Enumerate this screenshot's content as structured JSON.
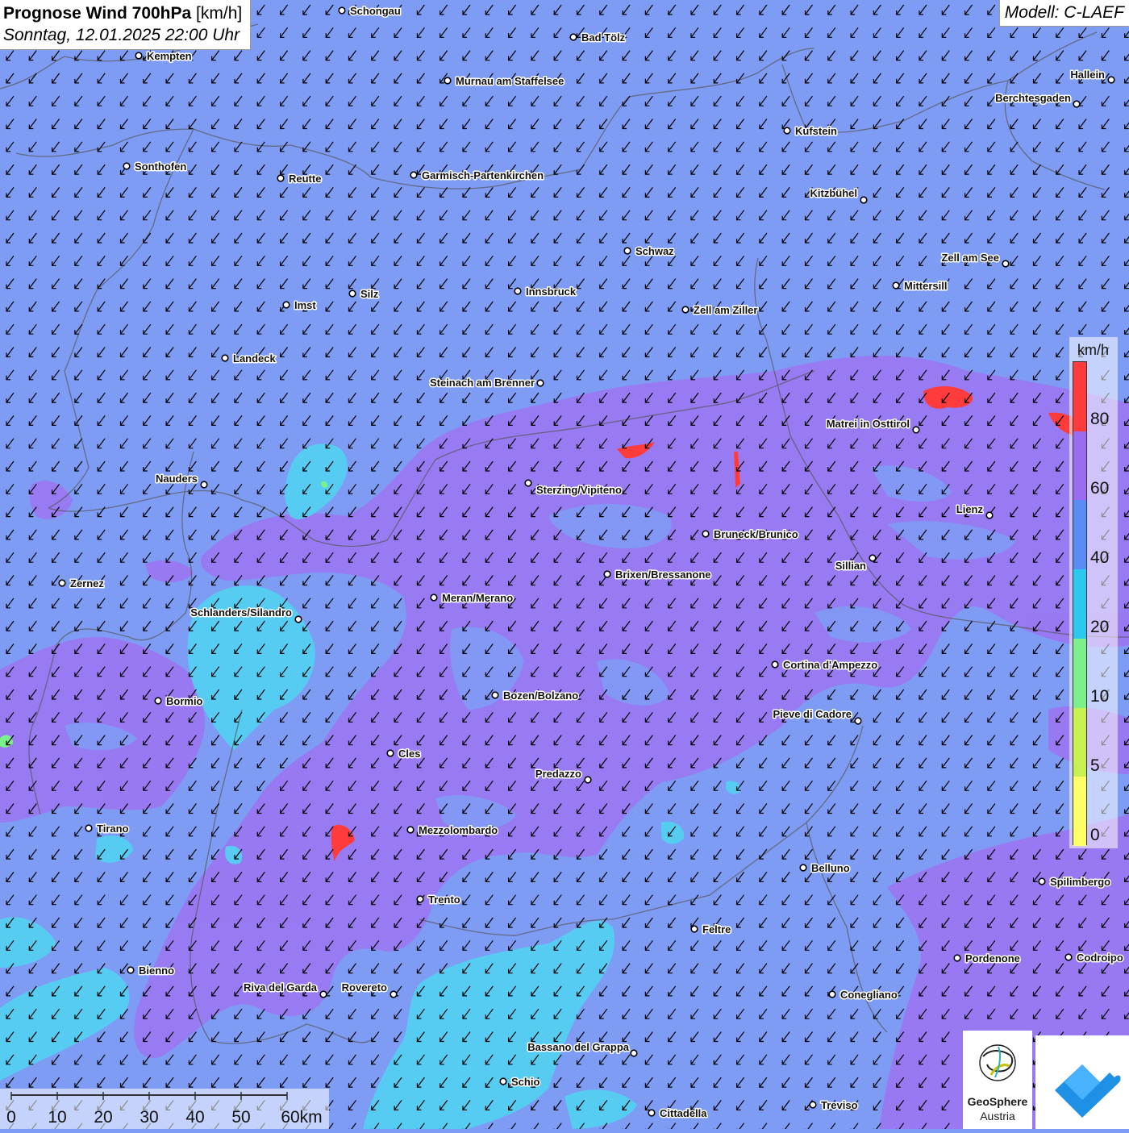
{
  "title": {
    "bold": "Prognose Wind 700hPa",
    "unit": "[km/h]",
    "datetime": "Sonntag, 12.01.2025 22:00 Uhr"
  },
  "model": "Modell: C-LAEF",
  "colors": {
    "background_40_60": "#7f9cf5",
    "band_60_80": "#9b7bf2",
    "band_20_40": "#4fd3f0",
    "band_80_plus": "#ff3b3b",
    "band_10_20": "#7cf08a",
    "arrow": "#000000"
  },
  "legend": {
    "unit": "km/h",
    "ticks": [
      "80",
      "60",
      "40",
      "20",
      "10",
      "5",
      "0"
    ],
    "segments": [
      {
        "color": "#ff3b3b"
      },
      {
        "color": "#9b6cf2"
      },
      {
        "color": "#5a8cf5"
      },
      {
        "color": "#2bc8f0"
      },
      {
        "color": "#7cf08a"
      },
      {
        "color": "#c8f050"
      },
      {
        "color": "#ffff66"
      }
    ]
  },
  "scalebar": {
    "ticks": [
      "0",
      "10",
      "20",
      "30",
      "40",
      "50",
      "60km"
    ]
  },
  "logo": {
    "name": "GeoSphere",
    "sub": "Austria"
  },
  "cities": [
    {
      "name": "Schongau"
    },
    {
      "name": "Bad Tölz"
    },
    {
      "name": "Kempten"
    },
    {
      "name": "Murnau am Staffelsee"
    },
    {
      "name": "Hallein"
    },
    {
      "name": "Berchtesgaden"
    },
    {
      "name": "Kufstein"
    },
    {
      "name": "Sonthofen"
    },
    {
      "name": "Reutte"
    },
    {
      "name": "Garmisch-Partenkirchen"
    },
    {
      "name": "Kitzbühel"
    },
    {
      "name": "Schwaz"
    },
    {
      "name": "Zell am See"
    },
    {
      "name": "Mittersill"
    },
    {
      "name": "Innsbruck"
    },
    {
      "name": "Silz"
    },
    {
      "name": "Imst"
    },
    {
      "name": "Zell am Ziller"
    },
    {
      "name": "Landeck"
    },
    {
      "name": "Steinach am Brenner"
    },
    {
      "name": "Matrei in Osttirol"
    },
    {
      "name": "Nauders"
    },
    {
      "name": "Sterzing/Vipiteno"
    },
    {
      "name": "Lienz"
    },
    {
      "name": "Bruneck/Brunico"
    },
    {
      "name": "Sillian"
    },
    {
      "name": "Zernez"
    },
    {
      "name": "Brixen/Bressanone"
    },
    {
      "name": "Meran/Merano"
    },
    {
      "name": "Schlanders/Silandro"
    },
    {
      "name": "Cortina d'Ampezzo"
    },
    {
      "name": "Bozen/Bolzano"
    },
    {
      "name": "Bormio"
    },
    {
      "name": "Pieve di Cadore"
    },
    {
      "name": "Cles"
    },
    {
      "name": "Predazzo"
    },
    {
      "name": "Tirano"
    },
    {
      "name": "Mezzolombardo"
    },
    {
      "name": "Belluno"
    },
    {
      "name": "Spilimbergo"
    },
    {
      "name": "Trento"
    },
    {
      "name": "Feltre"
    },
    {
      "name": "Pordenone"
    },
    {
      "name": "Codroipo"
    },
    {
      "name": "Bienno"
    },
    {
      "name": "Riva del Garda"
    },
    {
      "name": "Rovereto"
    },
    {
      "name": "Conegliano"
    },
    {
      "name": "Bassano del Grappa"
    },
    {
      "name": "Schio"
    },
    {
      "name": "Treviso"
    },
    {
      "name": "Cittadella"
    }
  ]
}
